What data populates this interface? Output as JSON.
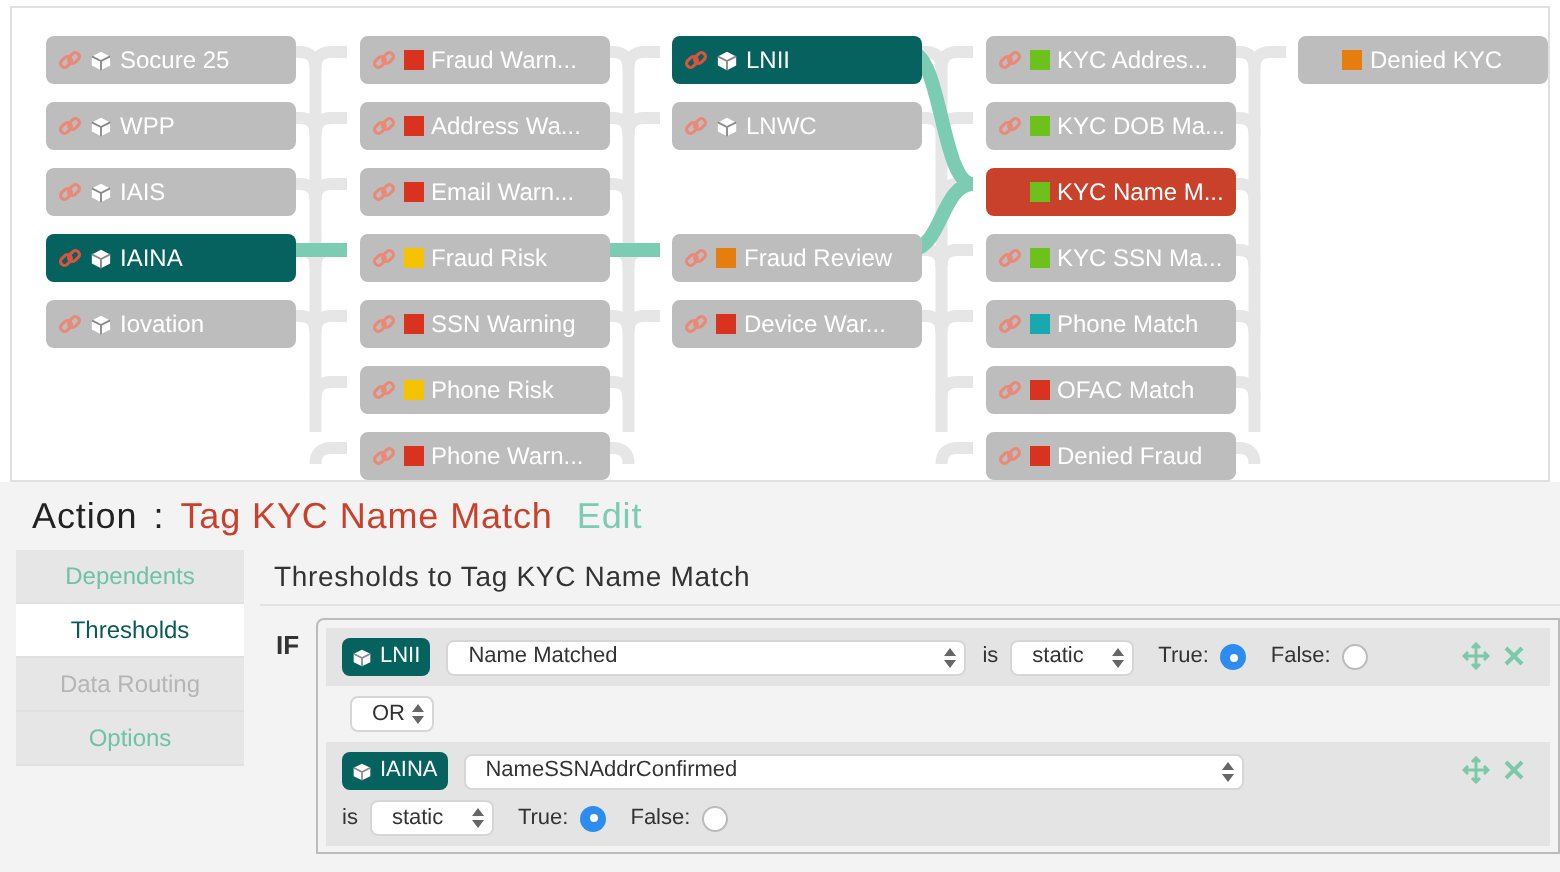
{
  "graph": {
    "columns": [
      {
        "nodes": [
          {
            "label": "Socure 25",
            "kind": "source",
            "link": true,
            "on_path": false,
            "selected": false
          },
          {
            "label": "WPP",
            "kind": "source",
            "link": true,
            "on_path": false,
            "selected": false
          },
          {
            "label": "IAIS",
            "kind": "source",
            "link": true,
            "on_path": false,
            "selected": false
          },
          {
            "label": "IAINA",
            "kind": "source",
            "link": true,
            "on_path": true,
            "selected": false
          },
          {
            "label": "Iovation",
            "kind": "source",
            "link": true,
            "on_path": false,
            "selected": false
          }
        ]
      },
      {
        "nodes": [
          {
            "label": "Fraud Warn...",
            "kind": "tag",
            "color": "#d9321f",
            "link": true,
            "on_path": false,
            "selected": false
          },
          {
            "label": "Address Wa...",
            "kind": "tag",
            "color": "#d9321f",
            "link": true,
            "on_path": false,
            "selected": false
          },
          {
            "label": "Email Warn...",
            "kind": "tag",
            "color": "#d9321f",
            "link": true,
            "on_path": false,
            "selected": false
          },
          {
            "label": "Fraud Risk",
            "kind": "tag",
            "color": "#f5c200",
            "link": true,
            "on_path": false,
            "selected": false
          },
          {
            "label": "SSN Warning",
            "kind": "tag",
            "color": "#d9321f",
            "link": true,
            "on_path": false,
            "selected": false
          },
          {
            "label": "Phone Risk",
            "kind": "tag",
            "color": "#f5c200",
            "link": true,
            "on_path": false,
            "selected": false
          },
          {
            "label": "Phone Warn...",
            "kind": "tag",
            "color": "#d9321f",
            "link": true,
            "on_path": false,
            "selected": false
          }
        ]
      },
      {
        "nodes": [
          {
            "label": "LNII",
            "kind": "source",
            "link": true,
            "on_path": true,
            "selected": false
          },
          {
            "label": "LNWC",
            "kind": "source",
            "link": true,
            "on_path": false,
            "selected": false
          },
          {
            "label": "Fraud Review",
            "kind": "tag",
            "color": "#e67e0f",
            "link": true,
            "on_path": false,
            "selected": false
          },
          {
            "label": "Device War...",
            "kind": "tag",
            "color": "#d9321f",
            "link": true,
            "on_path": false,
            "selected": false
          }
        ]
      },
      {
        "nodes": [
          {
            "label": "KYC Addres...",
            "kind": "tag",
            "color": "#6cc21b",
            "link": true,
            "on_path": false,
            "selected": false
          },
          {
            "label": "KYC DOB Ma...",
            "kind": "tag",
            "color": "#6cc21b",
            "link": true,
            "on_path": false,
            "selected": false
          },
          {
            "label": "KYC Name M...",
            "kind": "tag",
            "color": "#6cc21b",
            "link": false,
            "on_path": false,
            "selected": true
          },
          {
            "label": "KYC SSN Ma...",
            "kind": "tag",
            "color": "#6cc21b",
            "link": true,
            "on_path": false,
            "selected": false
          },
          {
            "label": "Phone Match",
            "kind": "tag",
            "color": "#17a8b0",
            "link": true,
            "on_path": false,
            "selected": false
          },
          {
            "label": "OFAC Match",
            "kind": "tag",
            "color": "#d9321f",
            "link": true,
            "on_path": false,
            "selected": false
          },
          {
            "label": "Denied Fraud",
            "kind": "tag",
            "color": "#d9321f",
            "link": true,
            "on_path": false,
            "selected": false
          }
        ]
      },
      {
        "nodes": [
          {
            "label": "Denied KYC",
            "kind": "tag",
            "color": "#e67e0f",
            "link": false,
            "on_path": false,
            "selected": false
          }
        ]
      }
    ]
  },
  "action": {
    "label": "Action",
    "separator": ":",
    "name": "Tag KYC Name Match",
    "edit": "Edit"
  },
  "sidebar": {
    "items": [
      {
        "label": "Dependents",
        "selected": false,
        "disabled": false
      },
      {
        "label": "Thresholds",
        "selected": true,
        "disabled": false
      },
      {
        "label": "Data Routing",
        "selected": false,
        "disabled": true
      },
      {
        "label": "Options",
        "selected": false,
        "disabled": false
      }
    ]
  },
  "thresholds": {
    "title": "Thresholds to Tag KYC Name Match",
    "if_label": "IF",
    "conditions": [
      {
        "source": "LNII",
        "field": "Name Matched",
        "is_label": "is",
        "mode": "static",
        "true_label": "True:",
        "false_label": "False:",
        "value": true,
        "kind": "inline"
      },
      {
        "source": "IAINA",
        "field": "NameSSNAddrConfirmed",
        "is_label": "is",
        "mode": "static",
        "true_label": "True:",
        "false_label": "False:",
        "value": true,
        "kind": "wrapped"
      }
    ],
    "operator": "OR"
  }
}
